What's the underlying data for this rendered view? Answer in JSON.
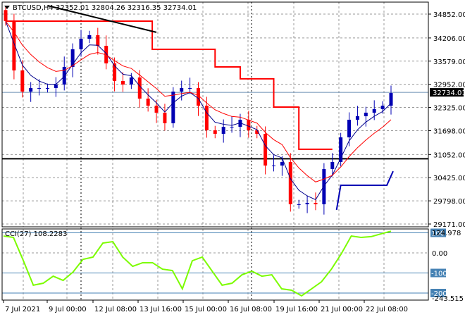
{
  "header": {
    "symbol": "BTCUSD,H4",
    "open": "32352.01",
    "high": "32804.26",
    "low": "32316.35",
    "close": "32734.01"
  },
  "colors": {
    "bull": "#0000b4",
    "bear": "#ff0000",
    "ma_fast": "#00008b",
    "ma_slow": "#ff0000",
    "cci": "#7cfc00",
    "level": "#4682b4",
    "tag": "#4682b4"
  },
  "chart_data": [
    {
      "type": "candlestick",
      "title": "BTCUSD,H4",
      "closes": [
        34661,
        33327,
        32755,
        32851,
        32851,
        32851,
        32946,
        33423,
        33899,
        34185,
        34280,
        33994,
        33518,
        33041,
        32946,
        33137,
        32565,
        32374,
        32184,
        31898,
        32755,
        32851,
        32851,
        32374,
        31707,
        31612,
        31802,
        31802,
        31993,
        31707,
        31612,
        30754,
        30754,
        30850,
        29706,
        29706,
        29744,
        29706,
        30659,
        30850,
        31517,
        31993,
        32088,
        32184,
        32279,
        32374,
        32717
      ],
      "ylim": [
        29171,
        34852
      ],
      "yticks": [
        "34852.00",
        "34206.00",
        "33579.00",
        "32952.00",
        "32325.00",
        "31698.00",
        "31052.00",
        "30425.00",
        "29798.00",
        "29171.00"
      ],
      "ytick_values": [
        34852,
        34206,
        33579,
        32952,
        32325,
        31698,
        31052,
        30425,
        29798,
        29171
      ],
      "current_price": "32734.01",
      "current_value": 32734.01,
      "horizontal_line": 31052,
      "trendline": [
        [
          34852,
          0.1
        ],
        [
          34206,
          0.36
        ]
      ],
      "upper_step": [
        [
          0,
          34661
        ],
        [
          0.35,
          34661
        ],
        [
          0.35,
          33899
        ],
        [
          0.5,
          33899
        ],
        [
          0.5,
          33423
        ],
        [
          0.56,
          33423
        ],
        [
          0.56,
          33100
        ],
        [
          0.64,
          33100
        ],
        [
          0.64,
          32336
        ],
        [
          0.7,
          32336
        ],
        [
          0.7,
          31193
        ],
        [
          0.78,
          31193
        ]
      ],
      "lower_step": [
        [
          0.79,
          29553
        ],
        [
          0.8,
          30220
        ],
        [
          0.91,
          30220
        ],
        [
          0.925,
          30600
        ]
      ],
      "xticks": [
        "7 Jul 2021",
        "9 Jul 00:00",
        "12 Jul 08:00",
        "13 Jul 16:00",
        "15 Jul 00:00",
        "16 Jul 08:00",
        "19 Jul 16:00",
        "21 Jul 00:00",
        "22 Jul 08:00"
      ]
    },
    {
      "type": "line",
      "title": "CCI(27)",
      "last": "108.2283",
      "label": "CCI(27) 108.2283",
      "values": [
        84,
        77,
        -39,
        -161,
        -151,
        -116,
        -137,
        -95,
        -32,
        -21,
        49,
        56,
        -21,
        -67,
        -49,
        -49,
        -81,
        -88,
        -179,
        -39,
        -21,
        -91,
        -161,
        -151,
        -109,
        -91,
        -116,
        -109,
        -179,
        -186,
        -214,
        -179,
        -144,
        -81,
        -4,
        84,
        77,
        81,
        95,
        108
      ],
      "ylim": [
        -243.515,
        124.978
      ],
      "ymax_label": "124.978",
      "ymin_label": "-243.515",
      "zero_label": "0.00",
      "levels": [
        100,
        -100,
        -200
      ],
      "level_labels": [
        "100",
        "-100",
        "-200"
      ]
    }
  ]
}
